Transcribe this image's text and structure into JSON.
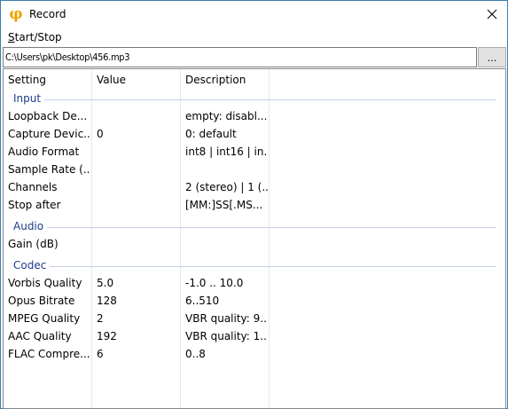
{
  "window": {
    "title": "Record",
    "app_icon": "phi-glyph",
    "close_icon": "close-icon"
  },
  "menu": {
    "start_stop_accel": "S",
    "start_stop_rest": "tart/Stop"
  },
  "path": {
    "value": "C:\\Users\\pk\\Desktop\\456.mp3",
    "browse_label": "..."
  },
  "table": {
    "headers": [
      "Setting",
      "Value",
      "Description"
    ],
    "groups": [
      {
        "name": "Input",
        "rows": [
          {
            "setting": "Loopback De...",
            "value": "",
            "description": "empty: disabl..."
          },
          {
            "setting": "Capture Devic...",
            "value": "0",
            "description": "0: default"
          },
          {
            "setting": "Audio Format",
            "value": "",
            "description": "int8 | int16 | in..."
          },
          {
            "setting": "Sample Rate (...",
            "value": "",
            "description": ""
          },
          {
            "setting": "Channels",
            "value": "",
            "description": "2 (stereo) | 1 (..."
          },
          {
            "setting": "Stop after",
            "value": "",
            "description": "[MM:]SS[.MS..."
          }
        ]
      },
      {
        "name": "Audio",
        "rows": [
          {
            "setting": "Gain (dB)",
            "value": "",
            "description": ""
          }
        ]
      },
      {
        "name": "Codec",
        "rows": [
          {
            "setting": "Vorbis Quality",
            "value": "5.0",
            "description": "-1.0 .. 10.0"
          },
          {
            "setting": "Opus Bitrate",
            "value": "128",
            "description": "6..510"
          },
          {
            "setting": "MPEG Quality",
            "value": "2",
            "description": "VBR quality: 9..."
          },
          {
            "setting": "AAC Quality",
            "value": "192",
            "description": "VBR quality: 1..."
          },
          {
            "setting": "FLAC Compre...",
            "value": "6",
            "description": "0..8"
          }
        ]
      }
    ]
  },
  "colors": {
    "accent_icon": "#f0a400",
    "group_label": "#1e3d8c",
    "window_border": "#3c7fb1"
  }
}
